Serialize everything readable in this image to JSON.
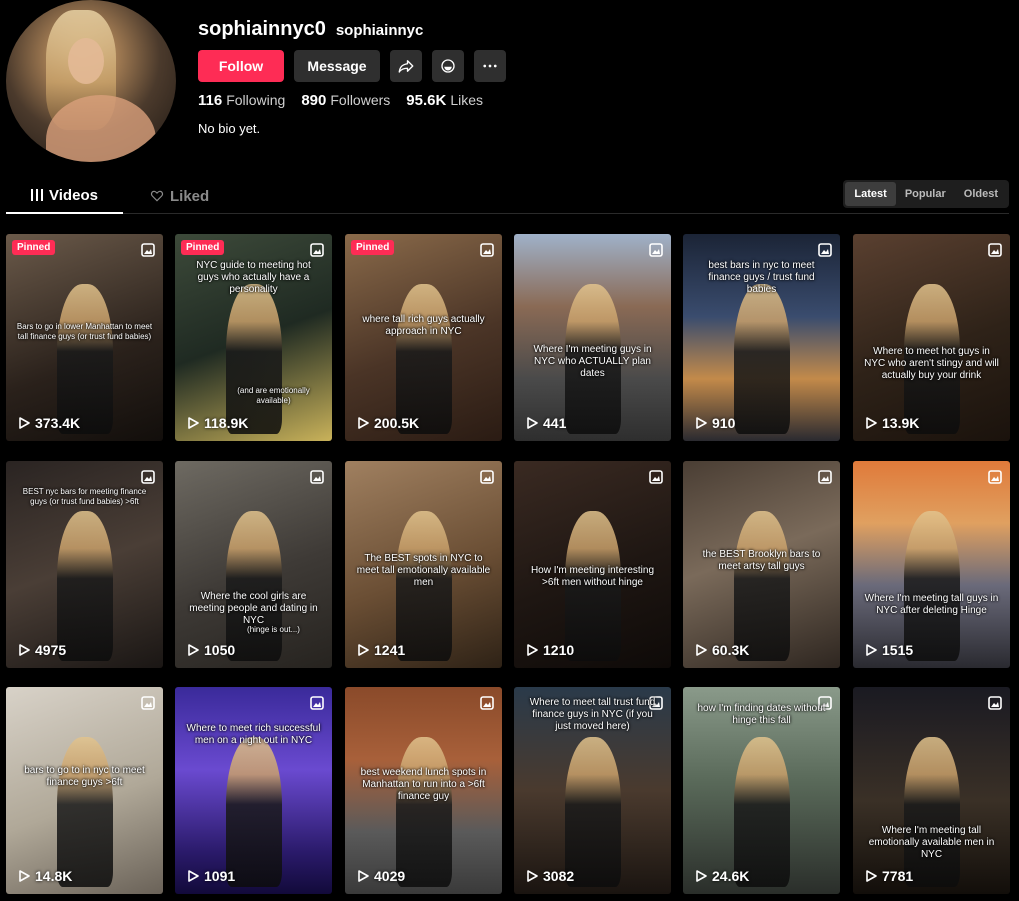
{
  "profile": {
    "username": "sophiainnyc0",
    "nickname": "sophiainnyc",
    "follow_label": "Follow",
    "message_label": "Message",
    "following_count": "116",
    "following_label": "Following",
    "followers_count": "890",
    "followers_label": "Followers",
    "likes_count": "95.6K",
    "likes_label": "Likes",
    "bio": "No bio yet."
  },
  "tabs": {
    "videos": "Videos",
    "liked": "Liked"
  },
  "sort": {
    "latest": "Latest",
    "popular": "Popular",
    "oldest": "Oldest"
  },
  "pinned_label": "Pinned",
  "videos": [
    {
      "views": "373.4K",
      "pinned": true,
      "caption": "Bars to go in lower Manhattan to meet tall finance guys (or trust fund babies)"
    },
    {
      "views": "118.9K",
      "pinned": true,
      "caption": "NYC guide to meeting hot guys who actually have a personality",
      "sub": "(and are emotionally available)"
    },
    {
      "views": "200.5K",
      "pinned": true,
      "caption": "where tall rich guys actually approach in NYC"
    },
    {
      "views": "441",
      "pinned": false,
      "caption": "Where I'm meeting guys in NYC who ACTUALLY plan dates"
    },
    {
      "views": "910",
      "pinned": false,
      "caption": "best bars in nyc to meet finance guys / trust fund babies"
    },
    {
      "views": "13.9K",
      "pinned": false,
      "caption": "Where to meet hot guys in NYC who aren't stingy and will actually buy your drink"
    },
    {
      "views": "4975",
      "pinned": false,
      "caption": "BEST nyc bars for meeting finance guys (or trust fund babies) >6ft"
    },
    {
      "views": "1050",
      "pinned": false,
      "caption": "Where the cool girls are meeting people and dating in NYC",
      "sub": "(hinge is out...)"
    },
    {
      "views": "1241",
      "pinned": false,
      "caption": "The BEST spots in NYC to meet tall emotionally available men"
    },
    {
      "views": "1210",
      "pinned": false,
      "caption": "How I'm meeting interesting >6ft men without hinge"
    },
    {
      "views": "60.3K",
      "pinned": false,
      "caption": "the BEST Brooklyn bars to meet artsy tall guys"
    },
    {
      "views": "1515",
      "pinned": false,
      "caption": "Where I'm meeting tall guys in NYC after deleting Hinge"
    },
    {
      "views": "14.8K",
      "pinned": false,
      "caption": "bars to go to in nyc to meet finance guys >6ft"
    },
    {
      "views": "1091",
      "pinned": false,
      "caption": "Where to meet rich successful men on a night out in NYC"
    },
    {
      "views": "4029",
      "pinned": false,
      "caption": "best weekend lunch spots in Manhattan to run into a >6ft finance guy"
    },
    {
      "views": "3082",
      "pinned": false,
      "caption": "Where to meet tall trust fund finance guys in NYC (if you just moved here)"
    },
    {
      "views": "24.6K",
      "pinned": false,
      "caption": "how I'm finding dates without hinge this fall"
    },
    {
      "views": "7781",
      "pinned": false,
      "caption": "Where I'm meeting tall emotionally available men in NYC"
    }
  ],
  "colors": {
    "accent": "#fe2c55",
    "button_dark": "#2f2f2f",
    "background": "#000000"
  },
  "icons": {
    "share": "share-arrow-icon",
    "repost": "repost-icon",
    "more": "more-dots-icon",
    "play": "play-icon",
    "gallery": "gallery-icon",
    "grid": "grid-icon",
    "heart": "heart-icon"
  }
}
